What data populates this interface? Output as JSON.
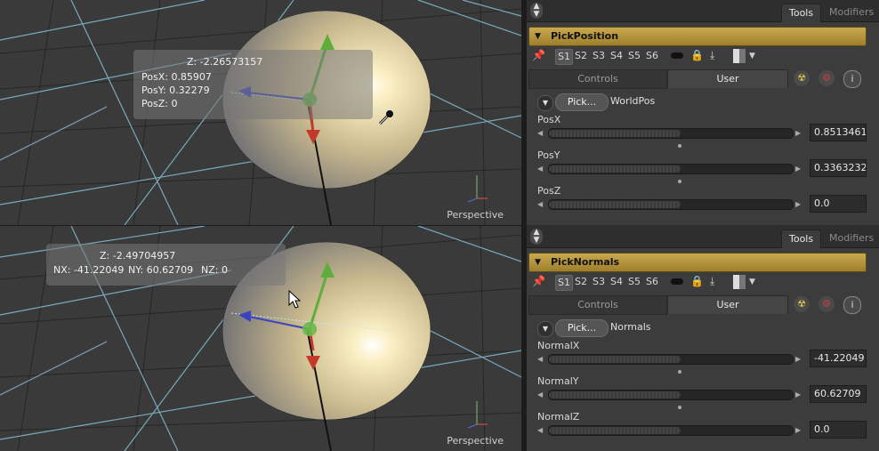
{
  "viewers": [
    {
      "hud": {
        "z": "Z: -2.26573157",
        "x": "PosX: 0.85907",
        "y": "PosY: 0.32279",
        "zval": "PosZ: 0"
      },
      "label": "Perspective"
    },
    {
      "hud": {
        "z": "Z: -2.49704957",
        "nx": "NX: -41.22049",
        "ny": "NY: 60.62709",
        "nz": "NZ: 0"
      },
      "label": "Perspective"
    }
  ],
  "panels": [
    {
      "tabs": {
        "tools": "Tools",
        "modifiers": "Modifiers"
      },
      "tool_name": "PickPosition",
      "slots": [
        "S1",
        "S2",
        "S3",
        "S4",
        "S5",
        "S6"
      ],
      "ctrl_tabs": {
        "controls": "Controls",
        "user": "User"
      },
      "pick_button": "Pick...",
      "pick_label": "WorldPos",
      "params": [
        {
          "label": "PosX",
          "value": "0.85134613",
          "fill": 0.54
        },
        {
          "label": "PosY",
          "value": "0.33632320",
          "fill": 0.54
        },
        {
          "label": "PosZ",
          "value": "0.0",
          "fill": 0.54
        }
      ]
    },
    {
      "tabs": {
        "tools": "Tools",
        "modifiers": "Modifiers"
      },
      "tool_name": "PickNormals",
      "slots": [
        "S1",
        "S2",
        "S3",
        "S4",
        "S5",
        "S6"
      ],
      "ctrl_tabs": {
        "controls": "Controls",
        "user": "User"
      },
      "pick_button": "Pick...",
      "pick_label": "Normals",
      "params": [
        {
          "label": "NormalX",
          "value": "-41.22049",
          "fill": 0.54
        },
        {
          "label": "NormalY",
          "value": "60.62709",
          "fill": 0.54
        },
        {
          "label": "NormalZ",
          "value": "0.0",
          "fill": 0.54
        }
      ]
    }
  ],
  "colors": {
    "tool_header": "#b8973f",
    "grid_line": "#7fb6c9",
    "sphere_light": "#fff6d6"
  },
  "icons": [
    "pin-icon",
    "lock-icon",
    "download-icon",
    "nuke-icon",
    "gear-icon",
    "info-icon",
    "eyedropper-icon",
    "arrow-cursor-icon"
  ]
}
